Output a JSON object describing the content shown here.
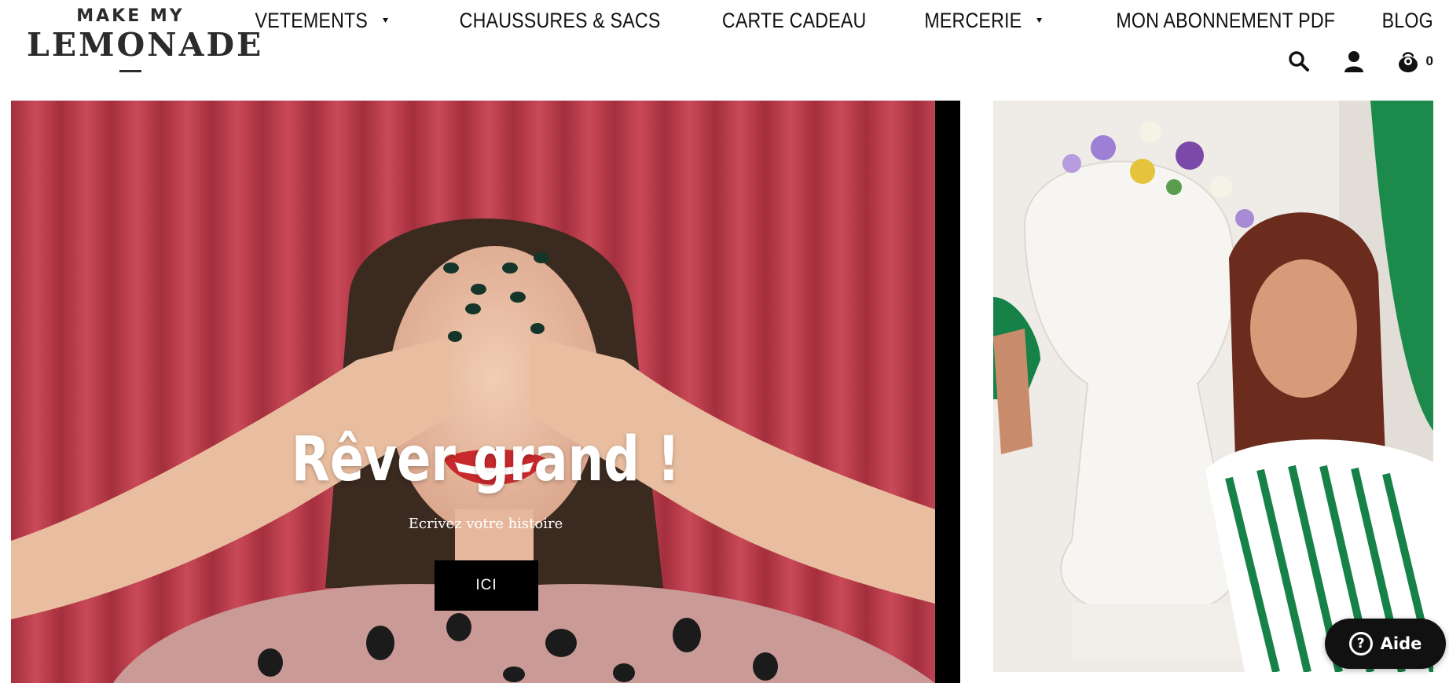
{
  "header": {
    "logo": {
      "top_text": "MAKE MY",
      "main_text": "LEMONADE"
    },
    "nav": [
      {
        "label": "VETEMENTS",
        "has_dropdown": true
      },
      {
        "label": "CHAUSSURES & SACS",
        "has_dropdown": false
      },
      {
        "label": "CARTE CADEAU",
        "has_dropdown": false
      },
      {
        "label": "MERCERIE",
        "has_dropdown": true
      },
      {
        "label": "MON ABONNEMENT PDF",
        "has_dropdown": false
      },
      {
        "label": "BLOG",
        "has_dropdown": false
      }
    ],
    "utilities": {
      "search_icon": "search-icon",
      "account_icon": "user-icon",
      "cart_icon": "cart-icon",
      "cart_count": "0"
    }
  },
  "hero": {
    "title": "Rêver grand !",
    "subtitle": "Ecrivez votre histoire",
    "cta_label": "ICI"
  },
  "help_button": {
    "icon": "question-icon",
    "label": "Aide"
  },
  "colors": {
    "curtain_red": "#b73b48",
    "button_black": "#000000",
    "green_curtain": "#1c8a4a"
  }
}
